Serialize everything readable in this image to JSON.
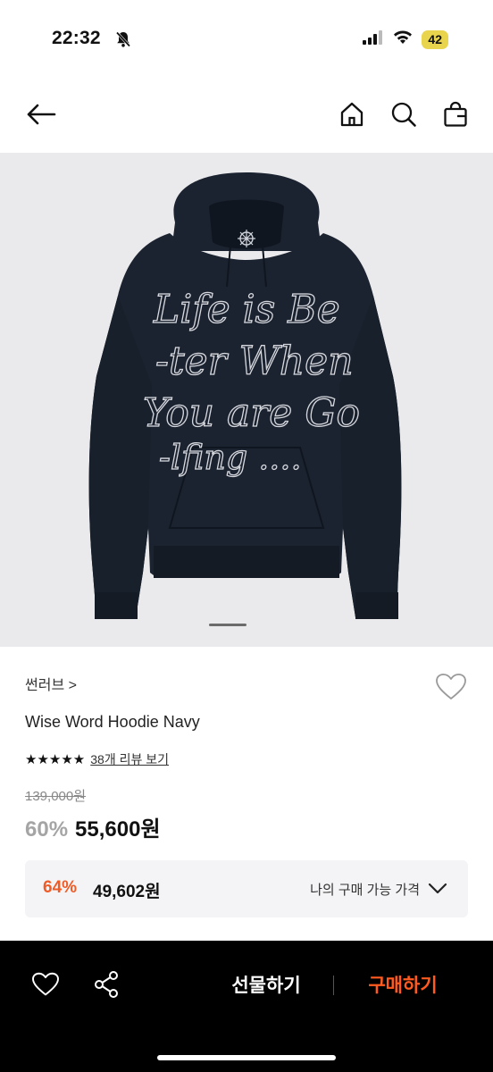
{
  "status_bar": {
    "time": "22:32",
    "battery": "42"
  },
  "nav": {
    "back_icon": "arrow-left-icon",
    "home_icon": "home-icon",
    "search_icon": "search-icon",
    "bag_icon": "shopping-bag-icon"
  },
  "hero": {
    "print_lines": [
      "Life is Be",
      "-ter When",
      "You are Go",
      "-lfing ...."
    ],
    "active_slide": 1
  },
  "product": {
    "brand": "썬러브 >",
    "name": "Wise Word Hoodie Navy",
    "stars": "★★★★★",
    "rating": 5,
    "review_link": "38개 리뷰 보기",
    "original_price": "139,000원",
    "discount": "60%",
    "price": "55,600원"
  },
  "promo": {
    "discount": "64%",
    "price": "49,602원",
    "label": "나의 구매 가능 가격"
  },
  "bottom_bar": {
    "gift_label": "선물하기",
    "buy_label": "구매하기"
  },
  "colors": {
    "accent_orange": "#ef5b26",
    "buy_orange": "#ff5a1f",
    "hoodie_navy": "#1c2330",
    "battery_yellow": "#e8d44d"
  }
}
